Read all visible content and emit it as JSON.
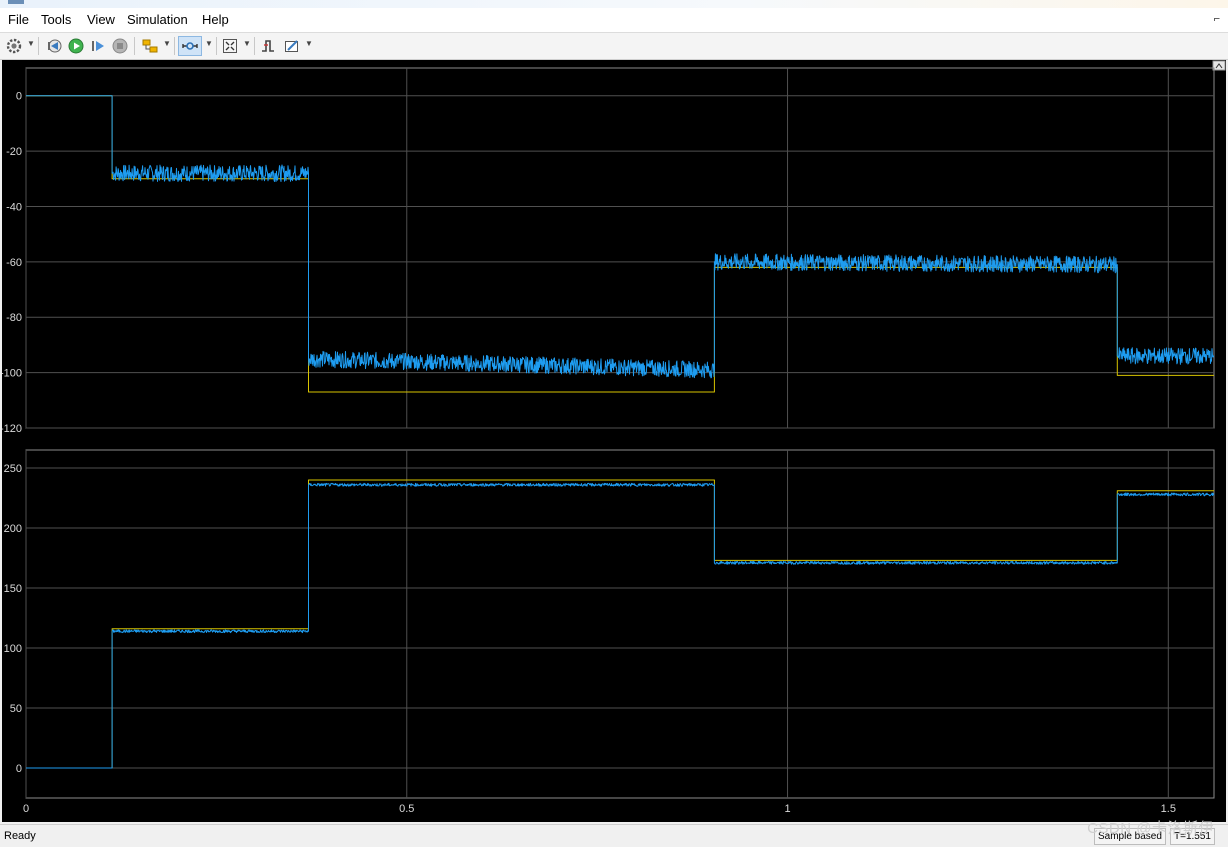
{
  "menu": {
    "items": [
      "File",
      "Tools",
      "View",
      "Simulation",
      "Help"
    ],
    "pin_glyph": "⌐"
  },
  "toolbar": {
    "icons": [
      "gear-icon",
      "step-back-icon",
      "run-icon",
      "step-forward-icon",
      "stop-icon",
      "highlight-icon",
      "zoom-icon",
      "fit-to-view-icon",
      "triggers-icon",
      "measurement-icon"
    ]
  },
  "status": {
    "ready": "Ready",
    "sample_based": "Sample based",
    "time": "T=1.551"
  },
  "watermark": "CSDN @卡洛斯伊",
  "colors": {
    "signal": "#1e9cf0",
    "reference": "#d8c400",
    "grid": "#505050",
    "scope_bg": "#000000"
  },
  "chart_data": [
    {
      "type": "line",
      "title": "",
      "xlabel": "",
      "ylabel": "",
      "xlim": [
        0,
        1.56
      ],
      "ylim": [
        -120,
        10
      ],
      "yticks": [
        0,
        -20,
        -40,
        -60,
        -80,
        -100,
        -120
      ],
      "xticks": [
        0,
        0.5,
        1,
        1.5
      ],
      "show_xtick_labels": false,
      "grid": true,
      "series": [
        {
          "color": "#d8c400",
          "x": [
            0,
            0.113,
            0.113,
            0.371,
            0.371,
            0.904,
            0.904,
            1.433,
            1.433,
            1.56
          ],
          "y": [
            0,
            0,
            -30,
            -30,
            -107,
            -107,
            -62,
            -62,
            -101,
            -101
          ]
        },
        {
          "color": "#1e9cf0",
          "x": [
            0,
            0.113,
            0.113,
            0.371,
            0.371,
            0.904,
            0.904,
            1.433,
            1.433,
            1.56
          ],
          "y": [
            0,
            0,
            -28,
            -28,
            -95,
            -99,
            -60,
            -61,
            -94,
            -94
          ],
          "noise": [
            0,
            0,
            3,
            3,
            3,
            3,
            3,
            3,
            3,
            3
          ]
        }
      ]
    },
    {
      "type": "line",
      "title": "",
      "xlabel": "",
      "ylabel": "",
      "xlim": [
        0,
        1.56
      ],
      "ylim": [
        -25,
        265
      ],
      "yticks": [
        0,
        50,
        100,
        150,
        200,
        250
      ],
      "xticks": [
        0,
        0.5,
        1,
        1.5
      ],
      "show_xtick_labels": true,
      "grid": true,
      "series": [
        {
          "color": "#d8c400",
          "x": [
            0,
            0.113,
            0.113,
            0.371,
            0.371,
            0.904,
            0.904,
            1.433,
            1.433,
            1.56
          ],
          "y": [
            0,
            0,
            116,
            116,
            240,
            240,
            173,
            173,
            231,
            231
          ]
        },
        {
          "color": "#1e9cf0",
          "x": [
            0,
            0.113,
            0.113,
            0.371,
            0.371,
            0.904,
            0.904,
            1.433,
            1.433,
            1.56
          ],
          "y": [
            0,
            0,
            114,
            114,
            236,
            236,
            171,
            171,
            228,
            228
          ],
          "noise": [
            0,
            0,
            1.2,
            1.2,
            1.2,
            1.2,
            1.2,
            1.2,
            1.2,
            1.2
          ]
        }
      ]
    }
  ]
}
